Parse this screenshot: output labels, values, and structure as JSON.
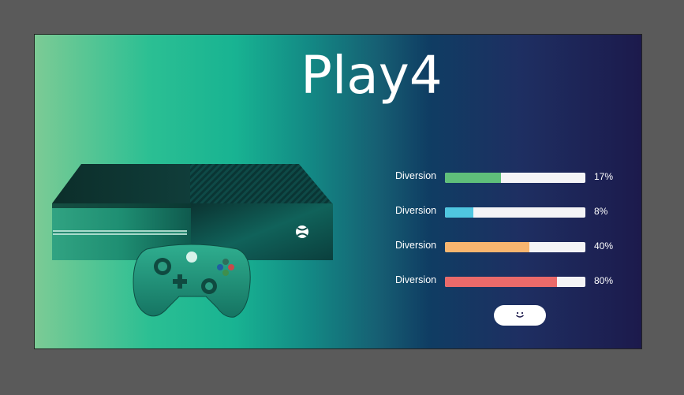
{
  "header": {
    "title": "Play4"
  },
  "stats": [
    {
      "label": "Diversion",
      "percent": 17,
      "value_text": "17%",
      "fill_fraction": 0.4,
      "color": "#5fbf7a"
    },
    {
      "label": "Diversion",
      "percent": 8,
      "value_text": "8%",
      "fill_fraction": 0.2,
      "color": "#4fc6e0"
    },
    {
      "label": "Diversion",
      "percent": 40,
      "value_text": "40%",
      "fill_fraction": 0.6,
      "color": "#f8b56f"
    },
    {
      "label": "Diversion",
      "percent": 80,
      "value_text": "80%",
      "fill_fraction": 0.8,
      "color": "#ea6a6a"
    }
  ],
  "action_button": {
    "icon": "smile-icon"
  },
  "colors": {
    "background_start": "#7ccb95",
    "background_end": "#1c1a4c",
    "track": "#f4f4f6",
    "text": "#ffffff"
  },
  "illustration": {
    "subject": "console-and-controller",
    "console_icon": "xbox-logo-icon"
  }
}
